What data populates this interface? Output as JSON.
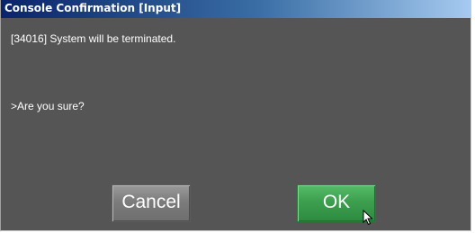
{
  "window": {
    "title": "Console Confirmation [Input]"
  },
  "message": {
    "line1": "[34016] System will be terminated.",
    "line2": ">Are you sure?"
  },
  "buttons": {
    "cancel_label": "Cancel",
    "ok_label": "OK"
  },
  "colors": {
    "dialog_background": "#555555",
    "titlebar_start": "#0a246a",
    "titlebar_end": "#a6caf0",
    "cancel_button": "#7c7c7c",
    "ok_button": "#3c9f4e"
  },
  "icons": {
    "cursor": "mouse-pointer-icon"
  }
}
